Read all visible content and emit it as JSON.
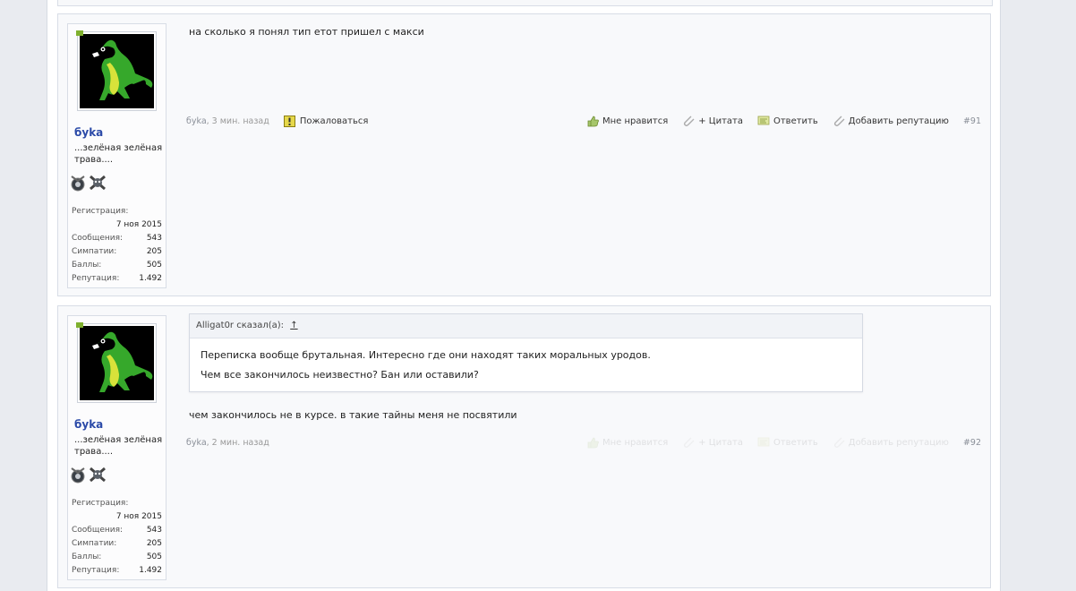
{
  "posts": [
    {
      "id": "91",
      "user": {
        "name": "бyka",
        "title": "...зелёная зелёная трава....",
        "stats": {
          "registered_label": "Регистрация:",
          "registered_value": "7 ноя 2015",
          "messages_label": "Сообщения:",
          "messages_value": "543",
          "likes_label": "Симпатии:",
          "likes_value": "205",
          "points_label": "Баллы:",
          "points_value": "505",
          "reputation_label": "Репутация:",
          "reputation_value": "1.492"
        }
      },
      "message": "на сколько я понял тип етот пришел с макси",
      "meta": {
        "author": "бyka",
        "time": ", 3 мин. назад",
        "report": "Пожаловаться",
        "like": "Мне нравится",
        "quote": "+ Цитата",
        "reply": "Ответить",
        "add_rep": "Добавить репутацию",
        "number": "#91"
      }
    },
    {
      "id": "92",
      "user": {
        "name": "бyka",
        "title": "...зелёная зелёная трава....",
        "stats": {
          "registered_label": "Регистрация:",
          "registered_value": "7 ноя 2015",
          "messages_label": "Сообщения:",
          "messages_value": "543",
          "likes_label": "Симпатии:",
          "likes_value": "205",
          "points_label": "Баллы:",
          "points_value": "505",
          "reputation_label": "Репутация:",
          "reputation_value": "1.492"
        }
      },
      "quote": {
        "author_line": "Alligat0r сказал(а):",
        "arrow": "↑",
        "lines": [
          "Переписка вообще брутальная. Интересно где они находят таких моральных уродов.",
          "Чем все закончилось неизвестно? Бан или оставили?"
        ]
      },
      "message": "чем закончилось не в курсе. в такие тайны меня не посвятили",
      "meta": {
        "author": "бyka",
        "time": ", 2 мин. назад",
        "like": "Мне нравится",
        "quote": "+ Цитата",
        "reply": "Ответить",
        "add_rep": "Добавить репутацию",
        "number": "#92"
      }
    }
  ],
  "colors": {
    "username": "#2b4aa8",
    "background": "#e9ebf0",
    "post_bg": "#f8f9fb"
  }
}
